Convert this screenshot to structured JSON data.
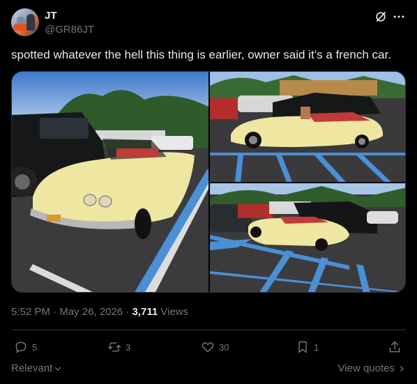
{
  "post": {
    "author_name": "JT",
    "author_handle": "@GR86JT",
    "text": "spotted whatever the hell this thing is earlier, owner said it’s a french car.",
    "time": "5:52 PM",
    "date": "May 26, 2026",
    "sep1": "·",
    "sep2": "·",
    "views_count": "3,711",
    "views_label": "Views"
  },
  "media": {
    "photo_count": 3,
    "photos": [
      {
        "subject": "yellow convertible car front view in parking lot"
      },
      {
        "subject": "yellow convertible car side view with driver"
      },
      {
        "subject": "yellow convertible car wide view in parking lot"
      }
    ]
  },
  "actions": {
    "replies": "5",
    "reposts": "3",
    "likes": "30",
    "bookmarks": "1"
  },
  "footer": {
    "sort_label": "Relevant",
    "view_quotes": "View quotes"
  },
  "icons": {
    "header": [
      "grok-icon",
      "more-icon"
    ],
    "actions": [
      "reply-icon",
      "repost-icon",
      "like-icon",
      "bookmark-icon",
      "share-icon"
    ]
  },
  "colors": {
    "background": "#000000",
    "text_primary": "#e7e9ea",
    "text_secondary": "#71767b",
    "divider": "#2f3336",
    "car_body": "#efe6a2",
    "parking_lines": "#4b8fd6"
  }
}
